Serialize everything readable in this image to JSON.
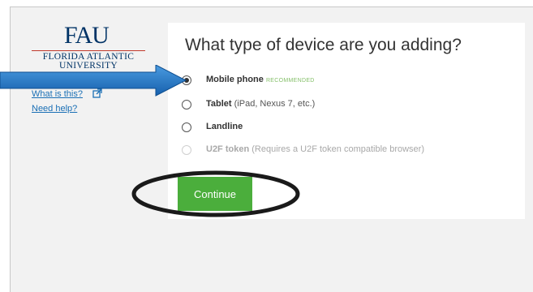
{
  "logo": {
    "mark": "FAU",
    "line1": "FLORIDA ATLANTIC",
    "line2": "UNIVERSITY"
  },
  "sidebar": {
    "what_is_this": "What is this?",
    "need_help": "Need help?"
  },
  "main": {
    "heading": "What type of device are you adding?",
    "options": [
      {
        "label": "Mobile phone",
        "detail": "",
        "badge": "RECOMMENDED",
        "checked": true,
        "disabled": false
      },
      {
        "label": "Tablet",
        "detail": " (iPad, Nexus 7, etc.)",
        "badge": "",
        "checked": false,
        "disabled": false
      },
      {
        "label": "Landline",
        "detail": "",
        "badge": "",
        "checked": false,
        "disabled": false
      },
      {
        "label": "U2F token",
        "detail": " (Requires a U2F token compatible browser)",
        "badge": "",
        "checked": false,
        "disabled": true
      }
    ],
    "continue_label": "Continue"
  },
  "colors": {
    "accent_green": "#4bae3c",
    "arrow_blue": "#1f78c8",
    "link_blue": "#1a6fb5",
    "brand_navy": "#003366"
  },
  "icons": {
    "external": "external-link-icon",
    "annotation_arrow": "arrow-right-icon"
  }
}
